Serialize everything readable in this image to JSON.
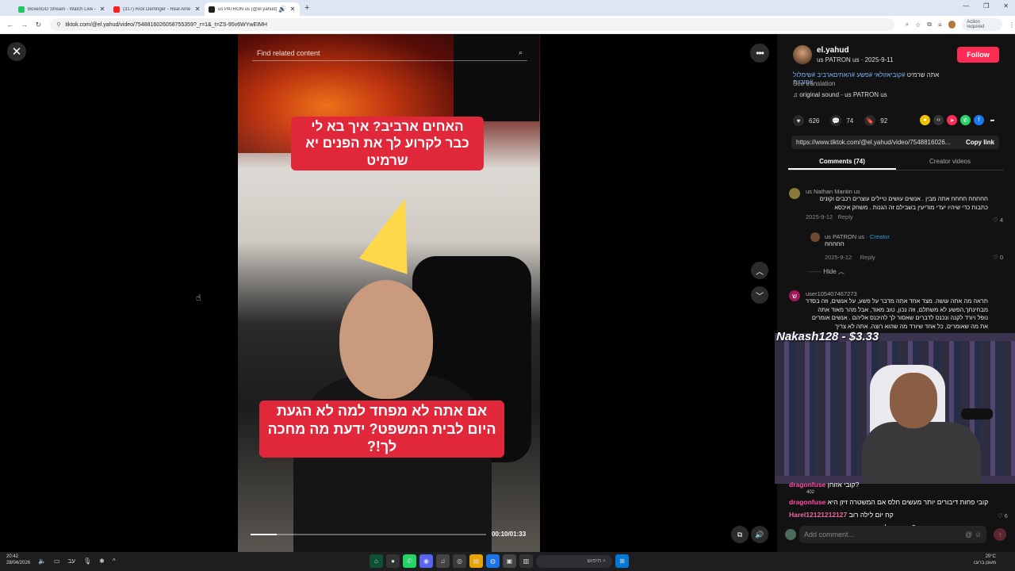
{
  "browser": {
    "tabs": [
      {
        "title": "BoxenGG Stream - Watch Live -",
        "color": "#22c55e"
      },
      {
        "title": "(317) Rick Derringer - Real Ame",
        "color": "#ff1e1e"
      },
      {
        "title": "us PATRON us (@el.yahud)",
        "color": "#222222"
      }
    ],
    "url": "tiktok.com/@el.yahud/video/7548816026058755359?_r=1&_t=ZS-95v6WYwEIMH",
    "action_required": "Action required"
  },
  "video": {
    "search_placeholder": "Find related content",
    "caption_top": "האחים ארביב? איך בא לי כבר לקרוע לך את הפנים יא שרמיט",
    "caption_bottom": "אם אתה לא מפחד למה לא הגעת היום לבית המשפט? ידעת מה מחכה לך!?",
    "timecode": "00:10/01:33",
    "progress": 0.11
  },
  "post": {
    "username": "el.yahud",
    "subline": "us PATRON us · 2025-9-11",
    "follow_label": "Follow",
    "desc_text": "אתה שרמיט",
    "desc_tags": "#קוביאזולאי #פשע #האחיםארביב #שימלול #פוריית",
    "see_translation": "See translation",
    "music": "original sound - us PATRON us",
    "likes": "626",
    "comments": "74",
    "saves": "92",
    "link": "https://www.tiktok.com/@el.yahud/video/7548816026...",
    "copy_link": "Copy link",
    "tab_comments": "Comments (74)",
    "tab_creator": "Creator videos"
  },
  "comments": [
    {
      "user": "us Nathan Mantin us",
      "text": "חחחחח חחחח אתה מבין . אנשים עושים טיילים עוצרים רכבים וקונים כתבות כדי שיהיו יעדי מודיעין בשבילם זה הגנות . משחק איכסא",
      "date": "2025-9-12",
      "reply": "Reply",
      "likes": "4"
    },
    {
      "user": "us PATRON us",
      "creator": "· Creator",
      "text": "חחחחח",
      "date": "2025-9-12",
      "reply": "Reply",
      "likes": "0"
    },
    {
      "user": "user105407467273",
      "text": "תראה מה אתה עושה. מצד אחד אתה מדבר על פשע, על אנשים, וזה בסדר מבחינתך,הפשע לא משתלם, וזה נכון, טוב מאוד, אבל מהר מאוד אתה נופל ויורד לקנה ונכנס לדברים שאסור לך להיכנס אליהם . אנשים אומרים את מה שאומרים, כל אחד שיורד מה שהוא רוצה. אתה לא צריך"
    }
  ],
  "hide_label": "Hide",
  "stream": {
    "donation": "Nakash128 - $3.33",
    "chat": [
      {
        "name": "dragonfuse",
        "msg": "קובי אזוחן?"
      },
      {
        "name": "dragonfuse",
        "msg": "קובי פחות דיבורים יותר מעשים חלס אם המשטרה זיזן היא"
      },
      {
        "name": "Harel12121212127",
        "msg": "קח יום לילה רוב"
      },
      {
        "name": "",
        "msg": "מי רוצה להסתקס איתי?"
      }
    ],
    "chat_badge": "402"
  },
  "comment_input_placeholder": "Add comment...",
  "taskbar": {
    "time": "20:42",
    "date": "28/04/2026",
    "search": "חיפוש",
    "temp": "20°C",
    "weather": "מעונן ברובו"
  }
}
